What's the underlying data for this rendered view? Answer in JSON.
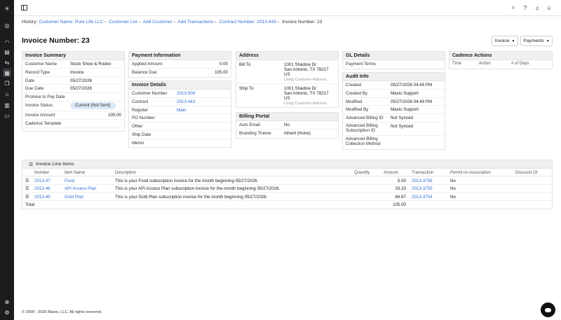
{
  "rail": {
    "icons": [
      "brand-logo-icon",
      "dashboard-icon",
      "revenue-icon",
      "customers-icon",
      "transfer-icon",
      "invoices-icon",
      "copy-icon",
      "banking-icon",
      "reports-icon",
      "billing-icon",
      "add-icon",
      "settings-icon"
    ]
  },
  "topbar": {
    "icons": [
      "search-icon",
      "help-icon",
      "notifications-icon",
      "user-icon"
    ]
  },
  "breadcrumb": {
    "prefix": "History:",
    "items": [
      "Customer Name: Pure Life LLC",
      "Customer List",
      "Add Customer",
      "Add Transactions",
      "Contract Number: 2013-443"
    ],
    "current": "Invoice Number: 23",
    "separator": "›"
  },
  "title": "Invoice Number: 23",
  "actions": {
    "invoice": "Invoice",
    "payments": "Payments"
  },
  "summary": {
    "title": "Invoice Summary",
    "rows": [
      {
        "k": "Customer Name",
        "v": "Stock Show & Rodeo"
      },
      {
        "k": "Record Type",
        "v": "Invoice"
      },
      {
        "k": "Date",
        "v": "05/27/2026"
      },
      {
        "k": "Due Date",
        "v": "05/27/2026"
      },
      {
        "k": "Promise to Pay Date",
        "v": ""
      },
      {
        "k": "Invoice Status",
        "v": "Current (Not Sent)"
      },
      {
        "k": "Invoice Amount",
        "v": "105.00"
      },
      {
        "k": "Cadence Template",
        "v": ""
      }
    ]
  },
  "payment": {
    "title": "Payment Information",
    "rows": [
      {
        "k": "Applied Amount",
        "v": "0.00"
      },
      {
        "k": "Balance Due",
        "v": "105.00"
      }
    ]
  },
  "details": {
    "title": "Invoice Details",
    "rows": [
      {
        "k": "Customer Number",
        "v": "2013-509"
      },
      {
        "k": "Contract",
        "v": "2013-443"
      },
      {
        "k": "Register",
        "v": "Main"
      },
      {
        "k": "PO Number",
        "v": ""
      },
      {
        "k": "Other",
        "v": ""
      },
      {
        "k": "Ship Date",
        "v": ""
      },
      {
        "k": "Memo",
        "v": ""
      }
    ]
  },
  "address": {
    "title": "Address",
    "bill_to_label": "Bill To",
    "bill_to_lines": [
      "1001 Shadow Dr",
      "San Antonio, TX 78217",
      "US"
    ],
    "bill_to_note": "Using Customer Address",
    "ship_to_label": "Ship To",
    "ship_to_lines": [
      "1001 Shadow Dr",
      "San Antonio, TX 78217",
      "US"
    ],
    "ship_to_note": "Using Customer Address"
  },
  "billing_portal": {
    "title": "Billing Portal",
    "rows": [
      {
        "k": "Auto Email",
        "v": "No"
      },
      {
        "k": "Branding Theme",
        "v": "Inherit (None)"
      }
    ]
  },
  "gl": {
    "title": "GL Details",
    "rows": [
      {
        "k": "Payment Terms",
        "v": ""
      }
    ]
  },
  "audit": {
    "title": "Audit Info",
    "rows": [
      {
        "k": "Created",
        "v": "05/27/2026 04:49 PM"
      },
      {
        "k": "Created By",
        "v": "Maxio Support"
      },
      {
        "k": "Modified",
        "v": "05/27/2026 04:49 PM"
      },
      {
        "k": "Modified By",
        "v": "Maxio Support"
      },
      {
        "k": "Advanced Billing ID",
        "v": "Not Synced"
      },
      {
        "k": "Advanced Billing Subscription ID",
        "v": "Not Synced"
      },
      {
        "k": "Advanced Billing Collection Method",
        "v": ""
      }
    ]
  },
  "cadence": {
    "title": "Cadence Actions",
    "cols": [
      "Time",
      "Action",
      "# of Days"
    ]
  },
  "line_items": {
    "title": "Invoice Line Items",
    "cols": [
      "Number",
      "Item Name",
      "Description",
      "Quantity",
      "Amount",
      "Transaction",
      "Permit no Association",
      "Discount Of"
    ],
    "rows": [
      {
        "number": "2013-47",
        "item": "Food",
        "desc": "This is your Food subscription invoice for the month beginning 05/27/2026.",
        "qty": "",
        "amount": "5.00",
        "txn": "2013-3756",
        "permit": "No",
        "discount": ""
      },
      {
        "number": "2013-46",
        "item": "API Access Plan",
        "desc": "This is your API Access Plan subscription invoice for the month beginning 05/27/2026.",
        "qty": "",
        "amount": "33.33",
        "txn": "2013-3755",
        "permit": "No",
        "discount": ""
      },
      {
        "number": "2013-45",
        "item": "Gold Plan",
        "desc": "This is your Gold Plan subscription invoice for the month beginning 05/27/2026.",
        "qty": "",
        "amount": "66.67",
        "txn": "2013-3754",
        "permit": "No",
        "discount": ""
      }
    ],
    "total_label": "Total",
    "total_value": "105.00"
  },
  "footer": "© 2009 - 2026 Maxio, LLC. All rights reserved."
}
